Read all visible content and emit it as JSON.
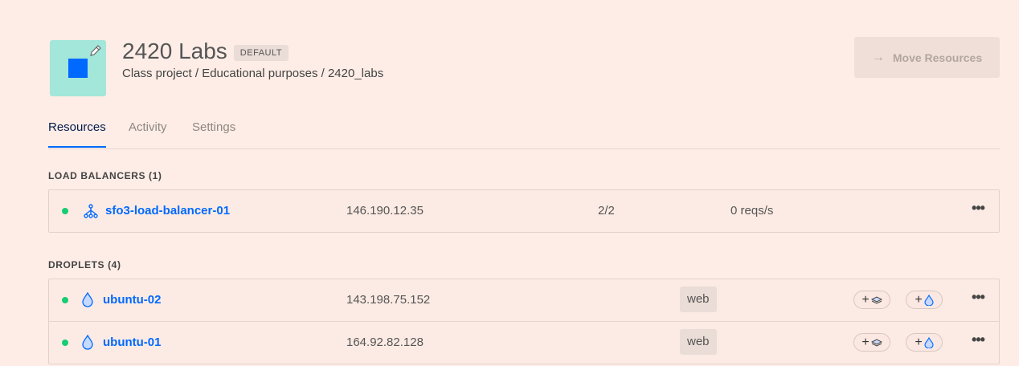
{
  "project": {
    "name": "2420 Labs",
    "badge": "DEFAULT",
    "subtitle": "Class project / Educational purposes / 2420_labs",
    "icon_color": "#a3e6da",
    "icon_square_color": "#0069ff"
  },
  "header": {
    "move_label": "Move Resources",
    "move_icon": "arrow-right-icon"
  },
  "tabs": [
    {
      "label": "Resources",
      "active": true
    },
    {
      "label": "Activity",
      "active": false
    },
    {
      "label": "Settings",
      "active": false
    }
  ],
  "load_balancers": {
    "title": "LOAD BALANCERS (1)",
    "items": [
      {
        "name": "sfo3-load-balancer-01",
        "ip": "146.190.12.35",
        "nodes": "2/2",
        "requests": "0 reqs/s",
        "status": "active"
      }
    ]
  },
  "droplets": {
    "title": "DROPLETS (4)",
    "items": [
      {
        "name": "ubuntu-02",
        "ip": "143.198.75.152",
        "tag": "web",
        "status": "active"
      },
      {
        "name": "ubuntu-01",
        "ip": "164.92.82.128",
        "tag": "web",
        "status": "active"
      }
    ]
  },
  "colors": {
    "accent": "#0069ff",
    "status_active": "#15cd72",
    "background": "#fdede6"
  }
}
